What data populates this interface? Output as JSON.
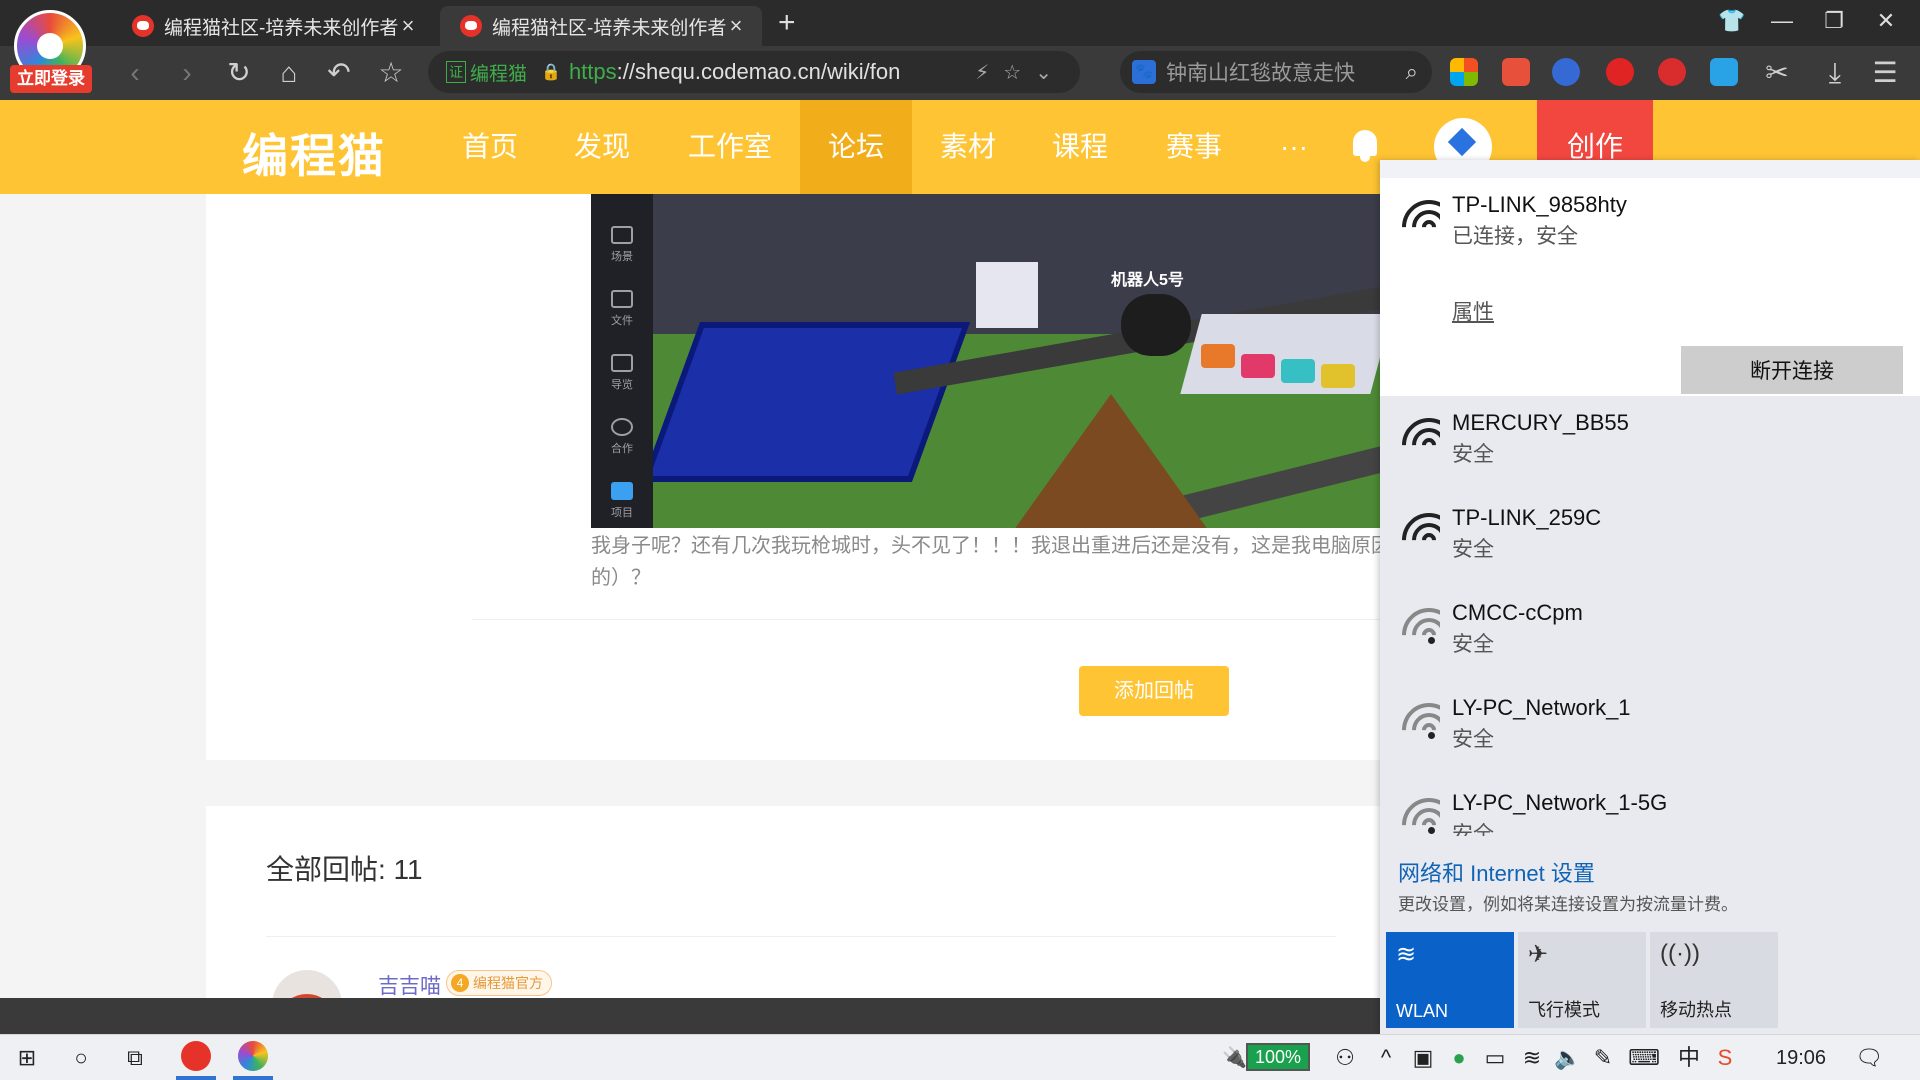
{
  "browser": {
    "profile_label": "立即登录",
    "tabs": [
      {
        "title": "编程猫社区-培养未来创作者",
        "active": false
      },
      {
        "title": "编程猫社区-培养未来创作者",
        "active": true
      }
    ],
    "new_tab": "+",
    "address": {
      "cert_badge": "证",
      "cert_name": "编程猫",
      "https": "https",
      "rest": "://shequ.codemao.cn/wiki/fon"
    },
    "search_placeholder": "钟南山红毯故意走快"
  },
  "site": {
    "brand": "编程猫",
    "menu": [
      "首页",
      "发现",
      "工作室",
      "论坛",
      "素材",
      "课程",
      "赛事",
      "···"
    ],
    "active_menu": "论坛",
    "create_label": "创作"
  },
  "post": {
    "scene_tools": [
      "场景",
      "文件",
      "导览",
      "合作",
      "项目"
    ],
    "robot_label": "机器人5号",
    "text": "我身子呢？还有几次我玩枪城时，头不见了！！！我退出重进后还是没有，这是我电脑原因吗？我电脑win10的）？",
    "reply_button": "添加回帖"
  },
  "replies": {
    "count_label": "全部回帖: 11",
    "first_user": "吉吉喵",
    "first_badge_level": "4",
    "first_badge": "编程猫官方"
  },
  "wifi_flyout": {
    "connected": {
      "ssid": "TP-LINK_9858hty",
      "state": "已连接，安全",
      "properties": "属性",
      "disconnect": "断开连接"
    },
    "networks": [
      {
        "ssid": "MERCURY_BB55",
        "state": "安全"
      },
      {
        "ssid": "TP-LINK_259C",
        "state": "安全"
      },
      {
        "ssid": "CMCC-cCpm",
        "state": "安全"
      },
      {
        "ssid": "LY-PC_Network_1",
        "state": "安全"
      },
      {
        "ssid": "LY-PC_Network_1-5G",
        "state": "安全"
      }
    ],
    "settings_link": "网络和 Internet 设置",
    "settings_desc": "更改设置，例如将某连接设置为按流量计费。",
    "quick_actions": [
      "WLAN",
      "飞行模式",
      "移动热点"
    ]
  },
  "taskbar": {
    "battery": "100%",
    "ime": "中",
    "time": "19:06"
  }
}
